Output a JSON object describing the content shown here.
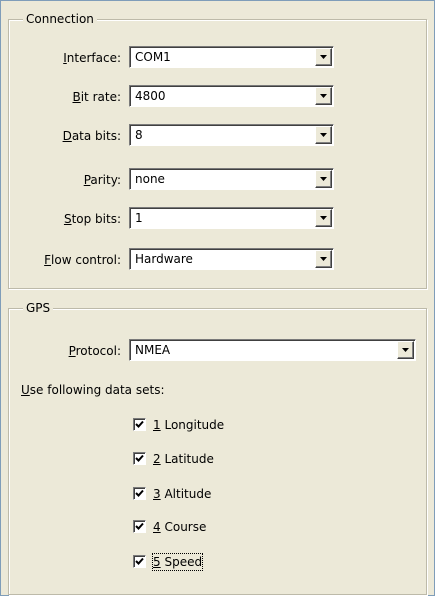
{
  "connection": {
    "title": "Connection",
    "fields": [
      {
        "key": "I",
        "label_rest": "nterface:",
        "value": "COM1"
      },
      {
        "key": "B",
        "label_rest": "it rate:",
        "value": "4800"
      },
      {
        "key": "D",
        "label_rest": "ata bits:",
        "value": "8"
      },
      {
        "key": "P",
        "label_rest": "arity:",
        "value": "none"
      },
      {
        "key": "S",
        "label_rest": "top bits:",
        "value": "1"
      },
      {
        "key": "F",
        "label_rest": "low control:",
        "value": "Hardware"
      }
    ]
  },
  "gps": {
    "title": "GPS",
    "protocol_key": "P",
    "protocol_rest": "rotocol:",
    "protocol_value": "NMEA",
    "datasets_key": "U",
    "datasets_rest": "se following data sets:",
    "datasets": [
      {
        "num": "1",
        "name": "Longitude",
        "checked": true
      },
      {
        "num": "2",
        "name": "Latitude",
        "checked": true
      },
      {
        "num": "3",
        "name": "Altitude",
        "checked": true
      },
      {
        "num": "4",
        "name": "Course",
        "checked": true
      },
      {
        "num": "5",
        "name": "Speed",
        "checked": true
      }
    ]
  }
}
